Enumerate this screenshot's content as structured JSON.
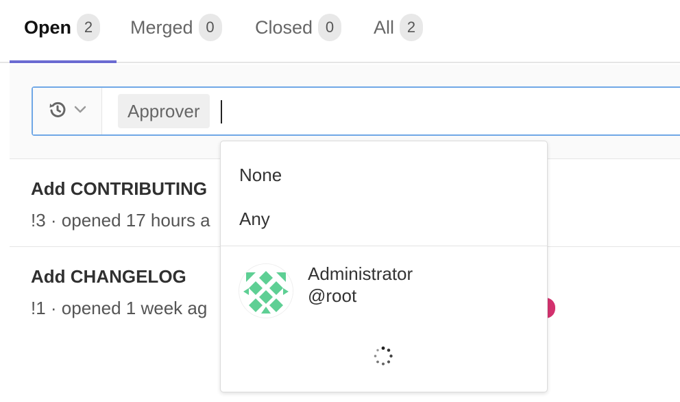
{
  "tabs": [
    {
      "label": "Open",
      "count": "2"
    },
    {
      "label": "Merged",
      "count": "0"
    },
    {
      "label": "Closed",
      "count": "0"
    },
    {
      "label": "All",
      "count": "2"
    }
  ],
  "filter": {
    "token": "Approver",
    "history_icon": "history-icon",
    "chevron_icon": "chevron-down-icon"
  },
  "merge_requests": [
    {
      "title": "Add CONTRIBUTING",
      "meta": "!3 · opened 17 hours a"
    },
    {
      "title": "Add CHANGELOG",
      "meta": "!1 · opened 1 week ag"
    }
  ],
  "dropdown": {
    "options": [
      "None",
      "Any"
    ],
    "user": {
      "name": "Administrator",
      "username": "@root"
    }
  },
  "colors": {
    "accent": "#6b6bd1",
    "focus_border": "#6fa7e6",
    "avatar_green": "#5ecf94",
    "label_pink": "#d3316e"
  }
}
